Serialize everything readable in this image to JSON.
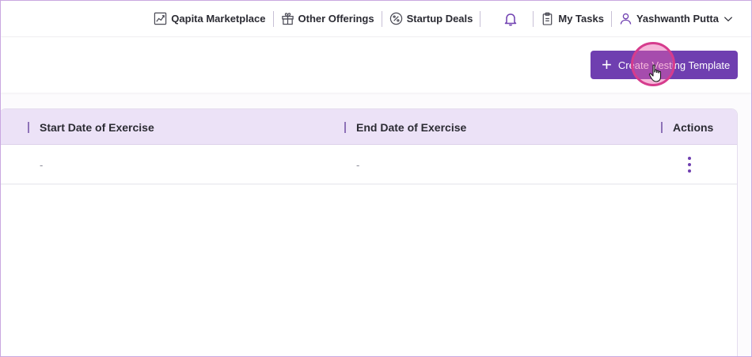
{
  "topnav": {
    "marketplace": "Qapita Marketplace",
    "other_offerings": "Other Offerings",
    "startup_deals": "Startup Deals",
    "my_tasks": "My Tasks",
    "user_name": "Yashwanth Putta"
  },
  "toolbar": {
    "create_label": "Create Vesting Template"
  },
  "table": {
    "columns": [
      "Start Date of Exercise",
      "End Date of Exercise",
      "Actions"
    ],
    "rows": [
      {
        "start": "-",
        "end": "-"
      }
    ]
  },
  "colors": {
    "accent": "#6f3fb0",
    "header_bg": "#ece2f7",
    "click_highlight": "#e85eaa"
  }
}
